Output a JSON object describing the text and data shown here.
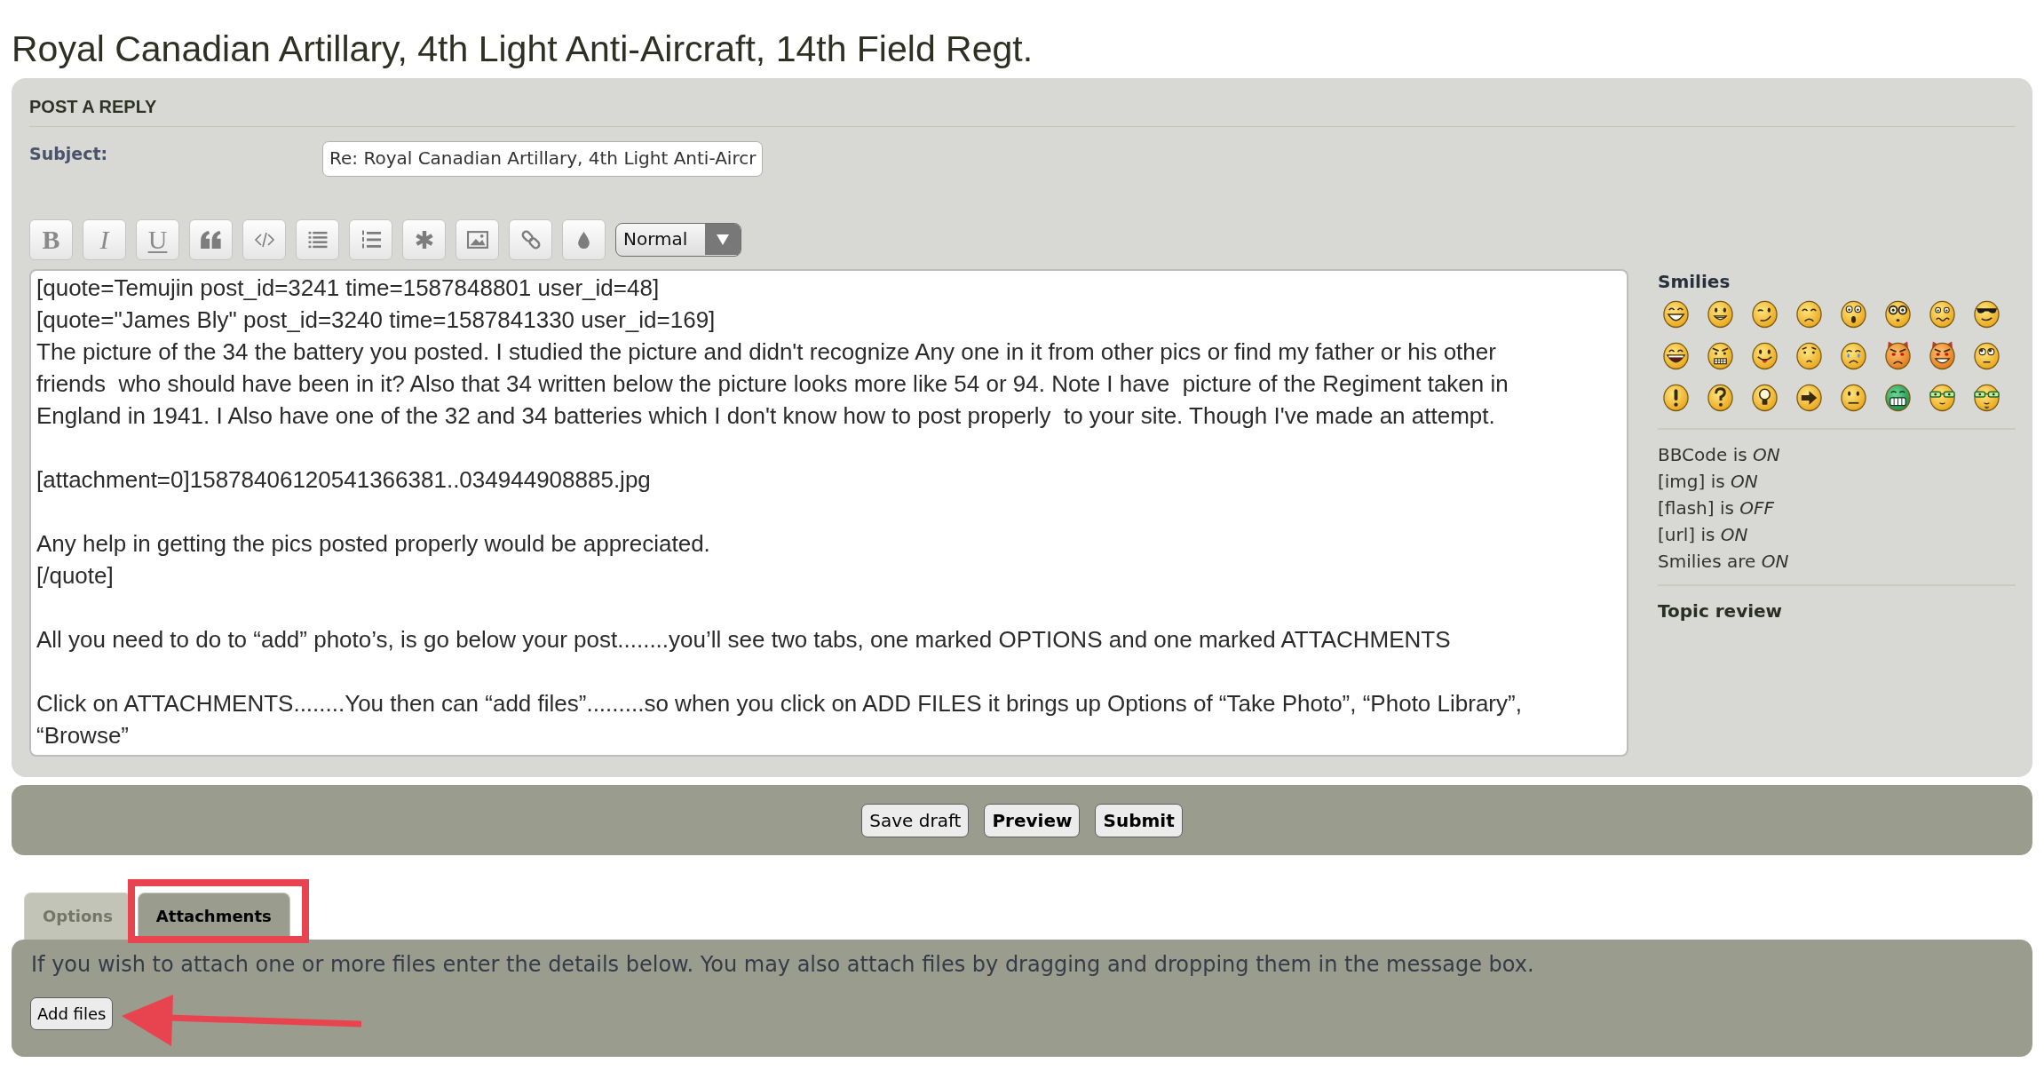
{
  "page_title": "Royal Canadian Artillary, 4th Light Anti-Aircraft, 14th Field Regt.",
  "post_form": {
    "heading": "POST A REPLY",
    "subject": {
      "label": "Subject:",
      "value": "Re: Royal Canadian Artillary, 4th Light Anti-Aircr"
    },
    "toolbar": {
      "buttons": [
        {
          "kind": "bold",
          "label": "B"
        },
        {
          "kind": "italic",
          "label": "I"
        },
        {
          "kind": "underline",
          "label": "U"
        },
        {
          "kind": "quote"
        },
        {
          "kind": "code"
        },
        {
          "kind": "list"
        },
        {
          "kind": "numbered_list"
        },
        {
          "kind": "list_item"
        },
        {
          "kind": "image"
        },
        {
          "kind": "link"
        },
        {
          "kind": "color"
        }
      ],
      "font_size_select": "Normal"
    },
    "message": {
      "blocks": [
        {
          "paragraphs": [
            {
              "lines": [
                "[quote=Temujin post_id=3241 time=1587848801 user_id=48]"
              ]
            },
            {
              "lines": [
                "[quote=\"James Bly\" post_id=3240 time=1587841330 user_id=169]"
              ]
            },
            {
              "lines": [
                "The picture of the 34 the battery you posted. I studied the picture and didn't recognize Any one in it from other pics or find my father or his other",
                "friends  who should have been in it? Also that 34 written below the picture looks more like 54 or 94. Note I have  picture of the Regiment taken in",
                "England in 1941. I Also have one of the 32 and 34 batteries which I don't know how to post properly  to your site. Though I've made an attempt."
              ]
            }
          ]
        },
        {
          "paragraphs": [
            {
              "lines": [
                "[attachment=0]15878406120541366381..034944908885.jpg"
              ]
            }
          ]
        },
        {
          "paragraphs": [
            {
              "lines": [
                "Any help in getting the pics posted properly would be appreciated."
              ]
            },
            {
              "lines": [
                "[/quote]"
              ]
            }
          ]
        },
        {
          "paragraphs": [
            {
              "lines": [
                "All you need to do to “add” photo’s, is go below your post........you’ll see two tabs, one marked OPTIONS and one marked ATTACHMENTS"
              ]
            }
          ]
        },
        {
          "paragraphs": [
            {
              "lines": [
                "Click on ATTACHMENTS........You then can “add files”.........so when you click on ADD FILES it brings up Options of “Take Photo”, “Photo Library”,",
                "“Browse”"
              ]
            }
          ]
        }
      ]
    },
    "sidebar": {
      "smilies_title": "Smilies",
      "settings": [
        "BBCode is *ON*",
        "[img] is *ON*",
        "[flash] is *OFF*",
        "[url] is *ON*",
        "Smilies are *ON*"
      ],
      "topic_review": "Topic review"
    }
  },
  "actions": [
    {
      "label": "Save draft",
      "primary": false
    },
    {
      "label": "Preview",
      "primary": true
    },
    {
      "label": "Submit",
      "primary": true
    }
  ],
  "tabs": [
    {
      "label": "Options",
      "selected": false,
      "highlighted": false
    },
    {
      "label": "Attachments",
      "selected": true,
      "highlighted": true
    }
  ],
  "attachments_panel": {
    "instructions": "If you wish to attach one or more files enter the details below. You may also attach files by dragging and dropping them in the message box.",
    "add_files": {
      "label": "Add files",
      "pointed_at": true
    }
  }
}
